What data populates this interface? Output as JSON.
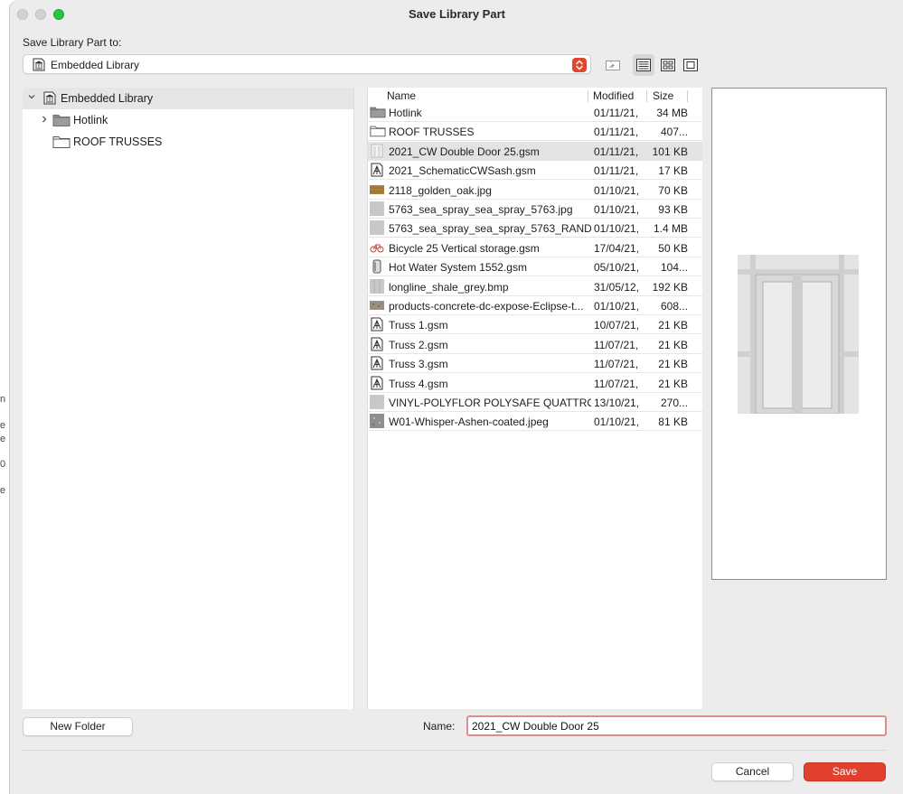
{
  "background_fragments": [
    "n",
    "e",
    "e",
    "0",
    "e"
  ],
  "window": {
    "title": "Save Library Part",
    "traffic_lights": [
      "close",
      "minimize",
      "zoom"
    ]
  },
  "destination": {
    "label": "Save Library Part to:",
    "selected": "Embedded Library",
    "icon": "library-icon",
    "accent": "#e0472f"
  },
  "toolbar": {
    "up_icon": "folder-up-icon",
    "views": [
      {
        "icon": "list-view-icon",
        "active": true
      },
      {
        "icon": "grid-view-icon",
        "active": false
      },
      {
        "icon": "preview-view-icon",
        "active": false
      }
    ]
  },
  "tree": [
    {
      "label": "Embedded Library",
      "icon": "library-icon",
      "expanded": true,
      "selected": true
    },
    {
      "label": "Hotlink",
      "icon": "folder-icon",
      "expanded": false
    },
    {
      "label": "ROOF TRUSSES",
      "icon": "folder-icon"
    }
  ],
  "columns": {
    "name": "Name",
    "modified": "Modified",
    "size": "Size"
  },
  "files": [
    {
      "name": "Hotlink",
      "modified": "01/11/21,",
      "size": "34 MB",
      "icon": "folder-dark"
    },
    {
      "name": "ROOF TRUSSES",
      "modified": "01/11/21,",
      "size": "407...",
      "icon": "folder-light"
    },
    {
      "name": "2021_CW Double Door 25.gsm",
      "modified": "01/11/21,",
      "size": "101 KB",
      "icon": "door",
      "selected": true
    },
    {
      "name": "2021_SchematicCWSash.gsm",
      "modified": "01/11/21,",
      "size": "17 KB",
      "icon": "gsm"
    },
    {
      "name": "2118_golden_oak.jpg",
      "modified": "01/10/21,",
      "size": "70 KB",
      "icon": "oak"
    },
    {
      "name": "5763_sea_spray_sea_spray_5763.jpg",
      "modified": "01/10/21,",
      "size": "93 KB",
      "icon": "grey"
    },
    {
      "name": "5763_sea_spray_sea_spray_5763_RAND...",
      "modified": "01/10/21,",
      "size": "1.4 MB",
      "icon": "grey"
    },
    {
      "name": "Bicycle 25 Vertical storage.gsm",
      "modified": "17/04/21,",
      "size": "50 KB",
      "icon": "bicycle"
    },
    {
      "name": "Hot Water System 1552.gsm",
      "modified": "05/10/21,",
      "size": "104...",
      "icon": "hws"
    },
    {
      "name": "longline_shale_grey.bmp",
      "modified": "31/05/12,",
      "size": "192 KB",
      "icon": "shale"
    },
    {
      "name": "products-concrete-dc-expose-Eclipse-t...",
      "modified": "01/10/21,",
      "size": "608...",
      "icon": "concrete"
    },
    {
      "name": "Truss 1.gsm",
      "modified": "10/07/21,",
      "size": "21 KB",
      "icon": "gsm"
    },
    {
      "name": "Truss 2.gsm",
      "modified": "11/07/21,",
      "size": "21 KB",
      "icon": "gsm"
    },
    {
      "name": "Truss 3.gsm",
      "modified": "11/07/21,",
      "size": "21 KB",
      "icon": "gsm"
    },
    {
      "name": "Truss 4.gsm",
      "modified": "11/07/21,",
      "size": "21 KB",
      "icon": "gsm"
    },
    {
      "name": "VINYL-POLYFLOR POLYSAFE QUATTRO...",
      "modified": "13/10/21,",
      "size": "270...",
      "icon": "grey"
    },
    {
      "name": "W01-Whisper-Ashen-coated.jpeg",
      "modified": "01/10/21,",
      "size": "81 KB",
      "icon": "whisper"
    }
  ],
  "preview": {
    "subject": "double-door-preview"
  },
  "footer": {
    "new_folder": "New Folder",
    "name_label": "Name:",
    "name_value": "2021_CW Double Door 25",
    "cancel": "Cancel",
    "save": "Save",
    "save_color": "#e2402e"
  }
}
